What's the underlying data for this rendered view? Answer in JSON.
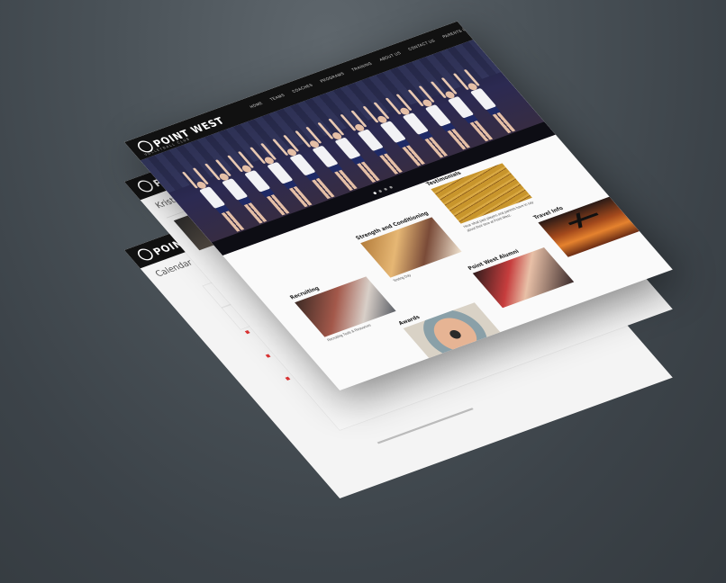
{
  "site": {
    "logo_text": "POINT WEST",
    "logo_subtext": "VOLLEYBALL CLUB",
    "nav": [
      "HOME",
      "TEAMS",
      "COACHES",
      "PROGRAMS",
      "TRAINING",
      "ABOUT US",
      "CONTACT US",
      "PARENTS LOGIN"
    ]
  },
  "back_pages": {
    "calendar_title": "Calendar",
    "profile_title": "Kristina Gr"
  },
  "sections": {
    "recruiting": {
      "title": "Recruiting",
      "caption": "Recruiting Tools & Resources"
    },
    "strength": {
      "title": "Strength and Conditioning",
      "caption": "Testing Day"
    },
    "testimonials": {
      "title": "Testimonials",
      "caption": "Hear what past players and parents have to say about their time at Point West."
    },
    "alumni": {
      "title": "Point West Alumni"
    },
    "awards": {
      "title": "Awards"
    },
    "travel": {
      "title": "Travel Info"
    }
  },
  "slider": {
    "current": 1,
    "total": 4
  }
}
